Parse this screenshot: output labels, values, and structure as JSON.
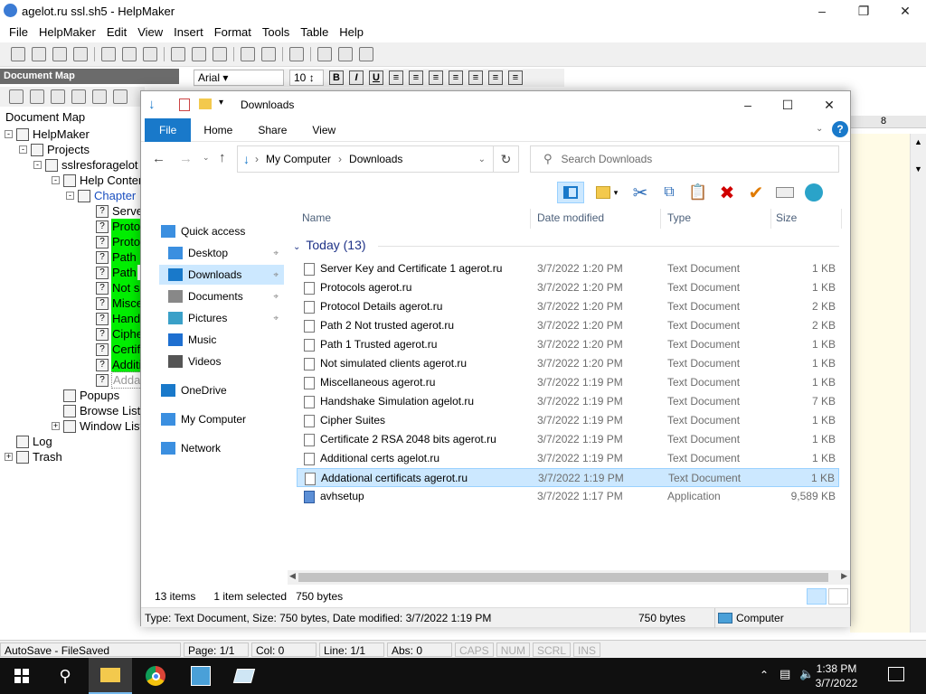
{
  "helpmaker": {
    "title": "agelot.ru ssl.sh5 - HelpMaker",
    "menu": [
      "File",
      "HelpMaker",
      "Edit",
      "View",
      "Insert",
      "Format",
      "Tools",
      "Table",
      "Help"
    ],
    "doc_map_header": "Document Map",
    "doc_map_label": "Document Map",
    "font_name": "Arial",
    "font_size": "10",
    "ruler_mark": "8",
    "tree": [
      {
        "label": "HelpMaker",
        "style": "normal"
      },
      {
        "label": "Projects",
        "style": "normal"
      },
      {
        "label": "sslresforagelot",
        "style": "normal"
      },
      {
        "label": "Help Conten",
        "style": "normal"
      },
      {
        "label": "Chapter",
        "style": "blue"
      },
      {
        "label": "Serve",
        "style": "normal"
      },
      {
        "label": "Proto",
        "style": "green"
      },
      {
        "label": "Proto",
        "style": "green"
      },
      {
        "label": "Path 2",
        "style": "green"
      },
      {
        "label": "Path",
        "style": "green"
      },
      {
        "label": "Not si",
        "style": "green"
      },
      {
        "label": "Misce",
        "style": "green"
      },
      {
        "label": "Hands",
        "style": "green"
      },
      {
        "label": "Ciphe",
        "style": "green"
      },
      {
        "label": "Certifi",
        "style": "green"
      },
      {
        "label": "Additi",
        "style": "green"
      },
      {
        "label": "Addat",
        "style": "gray"
      },
      {
        "label": "Popups",
        "style": "normal"
      },
      {
        "label": "Browse List",
        "style": "normal"
      },
      {
        "label": "Window List",
        "style": "normal"
      },
      {
        "label": "Log",
        "style": "normal"
      },
      {
        "label": "Trash",
        "style": "normal"
      }
    ],
    "status": {
      "autosave": "AutoSave - FileSaved",
      "page": "Page: 1/1",
      "col": "Col: 0",
      "line": "Line: 1/1",
      "abs": "Abs: 0",
      "caps": "CAPS",
      "num": "NUM",
      "scrl": "SCRL",
      "ins": "INS"
    }
  },
  "explorer": {
    "title": "Downloads",
    "ribbon_tabs": [
      "File",
      "Home",
      "Share",
      "View"
    ],
    "address": {
      "root": "My Computer",
      "folder": "Downloads"
    },
    "search_placeholder": "Search Downloads",
    "nav": [
      {
        "label": "Quick access",
        "pinned": false,
        "indent": 0
      },
      {
        "label": "Desktop",
        "pinned": true,
        "indent": 1
      },
      {
        "label": "Downloads",
        "pinned": true,
        "indent": 1,
        "selected": true
      },
      {
        "label": "Documents",
        "pinned": true,
        "indent": 1
      },
      {
        "label": "Pictures",
        "pinned": true,
        "indent": 1
      },
      {
        "label": "Music",
        "pinned": false,
        "indent": 1
      },
      {
        "label": "Videos",
        "pinned": false,
        "indent": 1
      },
      {
        "label": "OneDrive",
        "pinned": false,
        "indent": 0
      },
      {
        "label": "My Computer",
        "pinned": false,
        "indent": 0
      },
      {
        "label": "Network",
        "pinned": false,
        "indent": 0
      }
    ],
    "columns": {
      "name": "Name",
      "date": "Date modified",
      "type": "Type",
      "size": "Size"
    },
    "group": "Today (13)",
    "files": [
      {
        "name": "Server Key and Certificate 1 agerot.ru",
        "date": "3/7/2022 1:20 PM",
        "type": "Text Document",
        "size": "1 KB"
      },
      {
        "name": "Protocols agerot.ru",
        "date": "3/7/2022 1:20 PM",
        "type": "Text Document",
        "size": "1 KB"
      },
      {
        "name": "Protocol Details agerot.ru",
        "date": "3/7/2022 1:20 PM",
        "type": "Text Document",
        "size": "2 KB"
      },
      {
        "name": "Path 2 Not trusted agerot.ru",
        "date": "3/7/2022 1:20 PM",
        "type": "Text Document",
        "size": "2 KB"
      },
      {
        "name": "Path 1 Trusted agerot.ru",
        "date": "3/7/2022 1:20 PM",
        "type": "Text Document",
        "size": "1 KB"
      },
      {
        "name": "Not simulated clients agerot.ru",
        "date": "3/7/2022 1:20 PM",
        "type": "Text Document",
        "size": "1 KB"
      },
      {
        "name": "Miscellaneous agerot.ru",
        "date": "3/7/2022 1:19 PM",
        "type": "Text Document",
        "size": "1 KB"
      },
      {
        "name": "Handshake Simulation agelot.ru",
        "date": "3/7/2022 1:19 PM",
        "type": "Text Document",
        "size": "7 KB"
      },
      {
        "name": "Cipher Suites",
        "date": "3/7/2022 1:19 PM",
        "type": "Text Document",
        "size": "1 KB"
      },
      {
        "name": "Certificate 2 RSA 2048 bits agerot.ru",
        "date": "3/7/2022 1:19 PM",
        "type": "Text Document",
        "size": "1 KB"
      },
      {
        "name": "Additional certs agelot.ru",
        "date": "3/7/2022 1:19 PM",
        "type": "Text Document",
        "size": "1 KB"
      },
      {
        "name": "Addational certificats  agerot.ru",
        "date": "3/7/2022 1:19 PM",
        "type": "Text Document",
        "size": "1 KB",
        "selected": true
      },
      {
        "name": "avhsetup",
        "date": "3/7/2022 1:17 PM",
        "type": "Application",
        "size": "9,589 KB"
      }
    ],
    "status": {
      "items": "13 items",
      "selected": "1 item selected",
      "bytes": "750 bytes"
    },
    "info": {
      "details": "Type: Text Document, Size: 750 bytes, Date modified: 3/7/2022 1:19 PM",
      "size": "750 bytes",
      "location": "Computer"
    }
  },
  "taskbar": {
    "time": "1:38 PM",
    "date": "3/7/2022"
  },
  "colors": {
    "accent": "#1979ca",
    "selection": "#cce8ff",
    "tree_highlight": "#00ee00",
    "taskbar": "#101010"
  }
}
